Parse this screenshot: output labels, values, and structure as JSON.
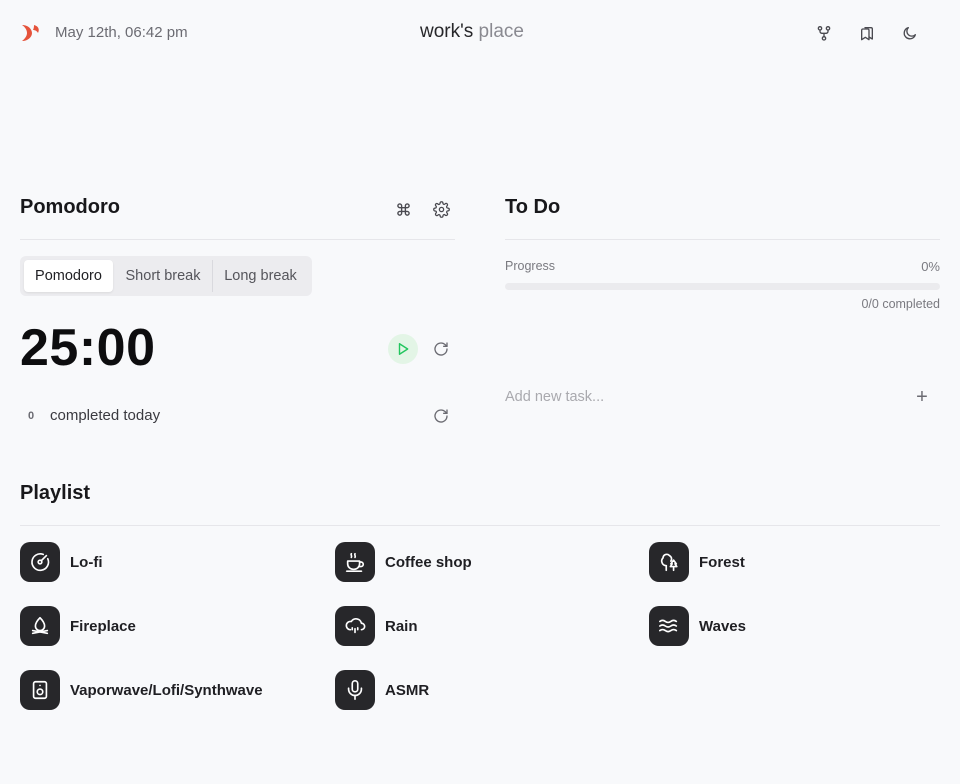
{
  "header": {
    "datetime": "May 12th, 06:42 pm",
    "title_part1": "work's",
    "title_part2": "place",
    "logo_icon": "logo-icon",
    "actions": [
      "fork-icon",
      "bookmarks-icon",
      "moon-icon"
    ]
  },
  "pomodoro": {
    "title": "Pomodoro",
    "tabs": [
      "Pomodoro",
      "Short break",
      "Long break"
    ],
    "active_tab": "Pomodoro",
    "timer": "25:00",
    "completed_count": "0",
    "completed_label": "completed today",
    "colors": {
      "play_bg": "#e3f5e6",
      "play_icon": "#22c55e"
    }
  },
  "todo": {
    "title": "To Do",
    "progress_label": "Progress",
    "progress_percent": "0%",
    "progress_value": 0,
    "completed_text": "0/0 completed",
    "input_placeholder": "Add new task...",
    "add_symbol": "+"
  },
  "playlist": {
    "title": "Playlist",
    "items": [
      {
        "label": "Lo-fi",
        "icon": "vinyl-icon"
      },
      {
        "label": "Coffee shop",
        "icon": "coffee-icon"
      },
      {
        "label": "Forest",
        "icon": "trees-icon"
      },
      {
        "label": "Fireplace",
        "icon": "flame-icon"
      },
      {
        "label": "Rain",
        "icon": "cloud-rain-icon"
      },
      {
        "label": "Waves",
        "icon": "waves-icon"
      },
      {
        "label": "Vaporwave/Lofi/Synthwave",
        "icon": "speaker-icon"
      },
      {
        "label": "ASMR",
        "icon": "mic-icon"
      }
    ]
  }
}
